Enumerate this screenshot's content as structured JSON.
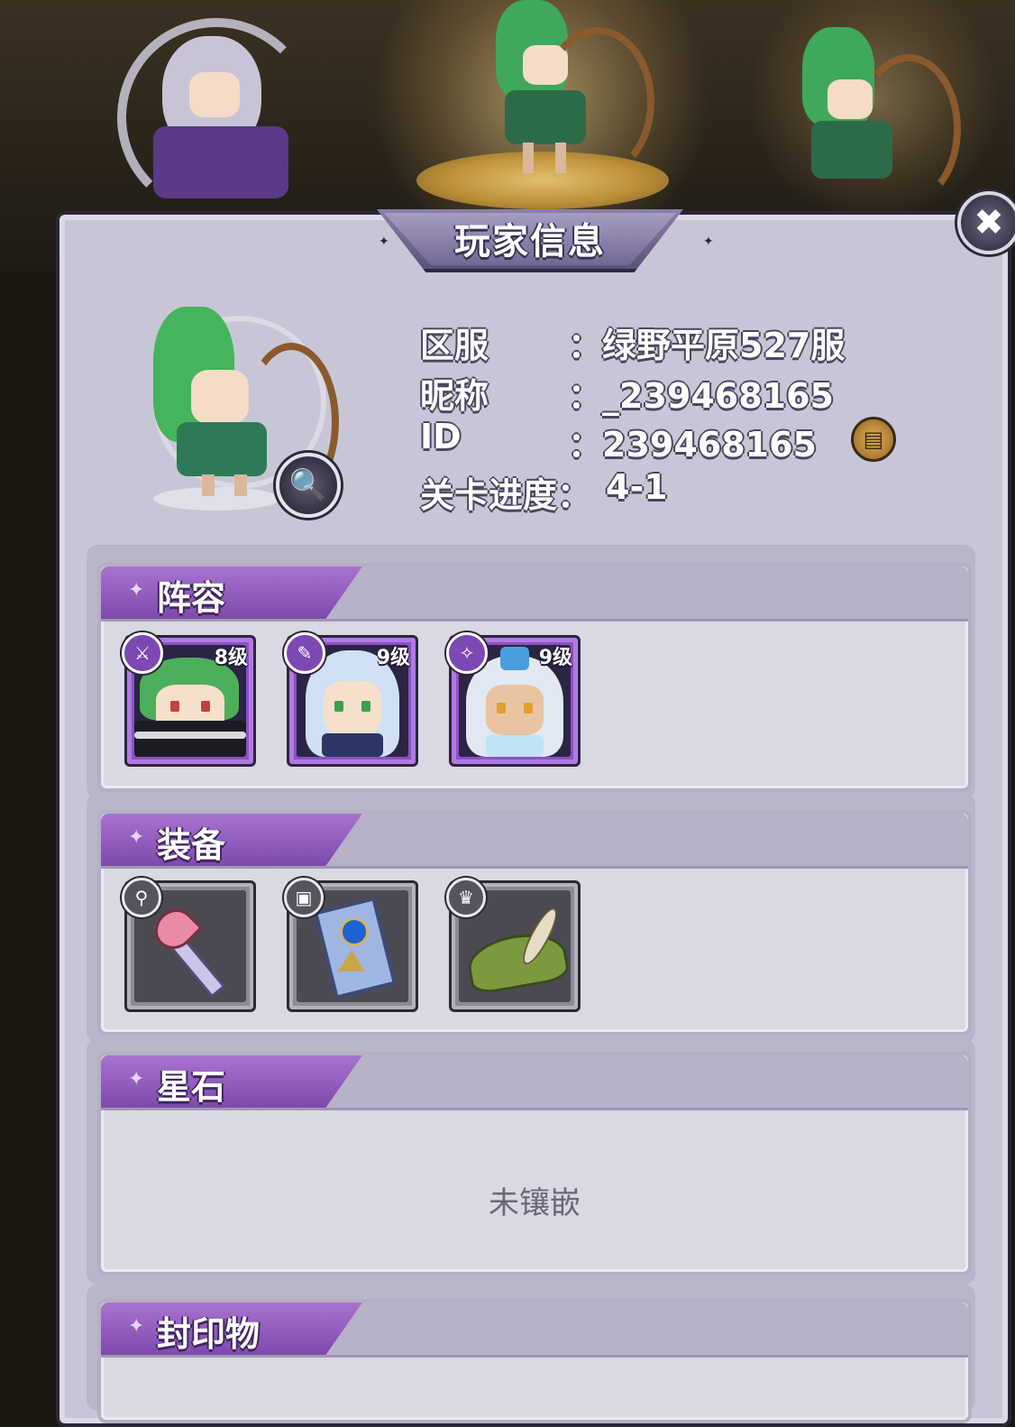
{
  "dialog": {
    "title": "玩家信息"
  },
  "player": {
    "server_label": "区服",
    "server_value": "：绿野平原527服",
    "nickname_label": "昵称",
    "nickname_value": "：_239468165",
    "id_label": "ID",
    "id_value": "：239468165",
    "progress_label": "关卡进度：",
    "progress_value": "4-1"
  },
  "sections": {
    "lineup": {
      "title": "阵容",
      "heroes": [
        {
          "level": "8级",
          "role_icon": "sword-icon",
          "hair": "#4caf5a"
        },
        {
          "level": "9级",
          "role_icon": "staff-icon",
          "hair": "#c9dcf2"
        },
        {
          "level": "9级",
          "role_icon": "wand-icon",
          "hair": "#dbe3f0"
        }
      ]
    },
    "equipment": {
      "title": "装备",
      "items": [
        {
          "slot_icon": "weapon-slot-icon",
          "item": "heart-scepter"
        },
        {
          "slot_icon": "accessory-slot-icon",
          "item": "tarot-card"
        },
        {
          "slot_icon": "helmet-slot-icon",
          "item": "feathered-hat"
        }
      ]
    },
    "starstone": {
      "title": "星石",
      "empty_text": "未镶嵌"
    },
    "seal": {
      "title": "封印物"
    }
  },
  "colors": {
    "accent": "#8a52c4",
    "panel": "#c8c6d6",
    "section": "#dad8e2"
  }
}
